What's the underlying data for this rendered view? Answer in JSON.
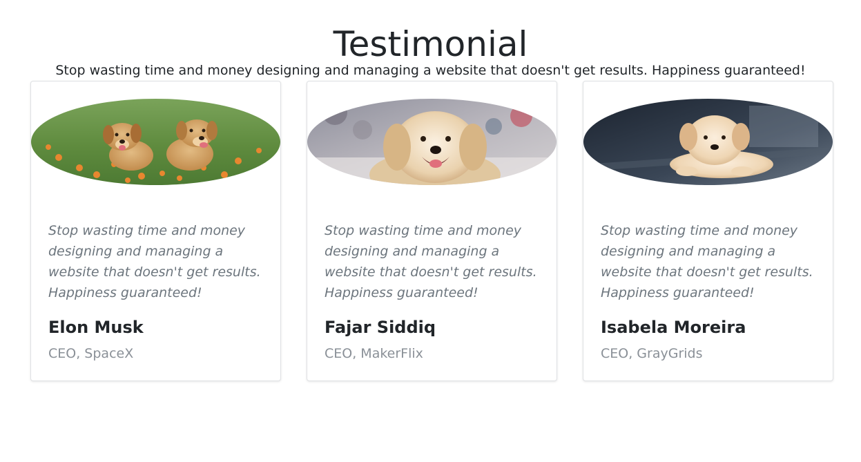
{
  "section": {
    "title": "Testimonial",
    "subtitle": "Stop wasting time and money designing and managing a website that doesn't get results. Happiness guaranteed!"
  },
  "testimonials": [
    {
      "quote": "Stop wasting time and money designing and managing a website that doesn't get results. Happiness guaranteed!",
      "name": "Elon Musk",
      "role": "CEO, SpaceX",
      "image": "two-puppies-in-flower-field-photo"
    },
    {
      "quote": "Stop wasting time and money designing and managing a website that doesn't get results. Happiness guaranteed!",
      "name": "Fajar Siddiq",
      "role": "CEO, MakerFlix",
      "image": "golden-retriever-smiling-photo"
    },
    {
      "quote": "Stop wasting time and money designing and managing a website that doesn't get results. Happiness guaranteed!",
      "name": "Isabela Moreira",
      "role": "CEO, GrayGrids",
      "image": "puppy-lying-on-dark-floor-photo"
    }
  ]
}
